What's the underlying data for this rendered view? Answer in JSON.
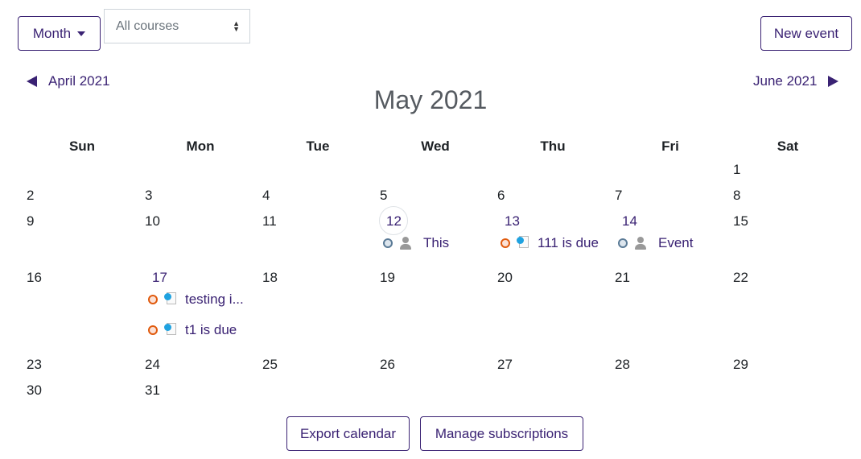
{
  "toolbar": {
    "view_label": "Month",
    "course_select": "All courses",
    "new_event_label": "New event"
  },
  "nav": {
    "prev_label": "April 2021",
    "next_label": "June 2021",
    "title": "May 2021"
  },
  "weekdays": [
    "Sun",
    "Mon",
    "Tue",
    "Wed",
    "Thu",
    "Fri",
    "Sat"
  ],
  "days": {
    "d1": "1",
    "d2": "2",
    "d3": "3",
    "d4": "4",
    "d5": "5",
    "d6": "6",
    "d7": "7",
    "d8": "8",
    "d9": "9",
    "d10": "10",
    "d11": "11",
    "d12": "12",
    "d13": "13",
    "d14": "14",
    "d15": "15",
    "d16": "16",
    "d17": "17",
    "d18": "18",
    "d19": "19",
    "d20": "20",
    "d21": "21",
    "d22": "22",
    "d23": "23",
    "d24": "24",
    "d25": "25",
    "d26": "26",
    "d27": "27",
    "d28": "28",
    "d29": "29",
    "d30": "30",
    "d31": "31"
  },
  "events": [
    {
      "day": 12,
      "type": "user",
      "label": "This"
    },
    {
      "day": 13,
      "type": "course",
      "label": "111 is due"
    },
    {
      "day": 14,
      "type": "user",
      "label": "Event"
    },
    {
      "day": 17,
      "type": "course",
      "label": "testing i..."
    },
    {
      "day": 17,
      "type": "course",
      "label": "t1 is due"
    }
  ],
  "footer": {
    "export_label": "Export calendar",
    "manage_label": "Manage subscriptions"
  },
  "colors": {
    "accent": "#3a2273",
    "course_event": "#e05a0d",
    "user_event": "#5a7a96"
  }
}
